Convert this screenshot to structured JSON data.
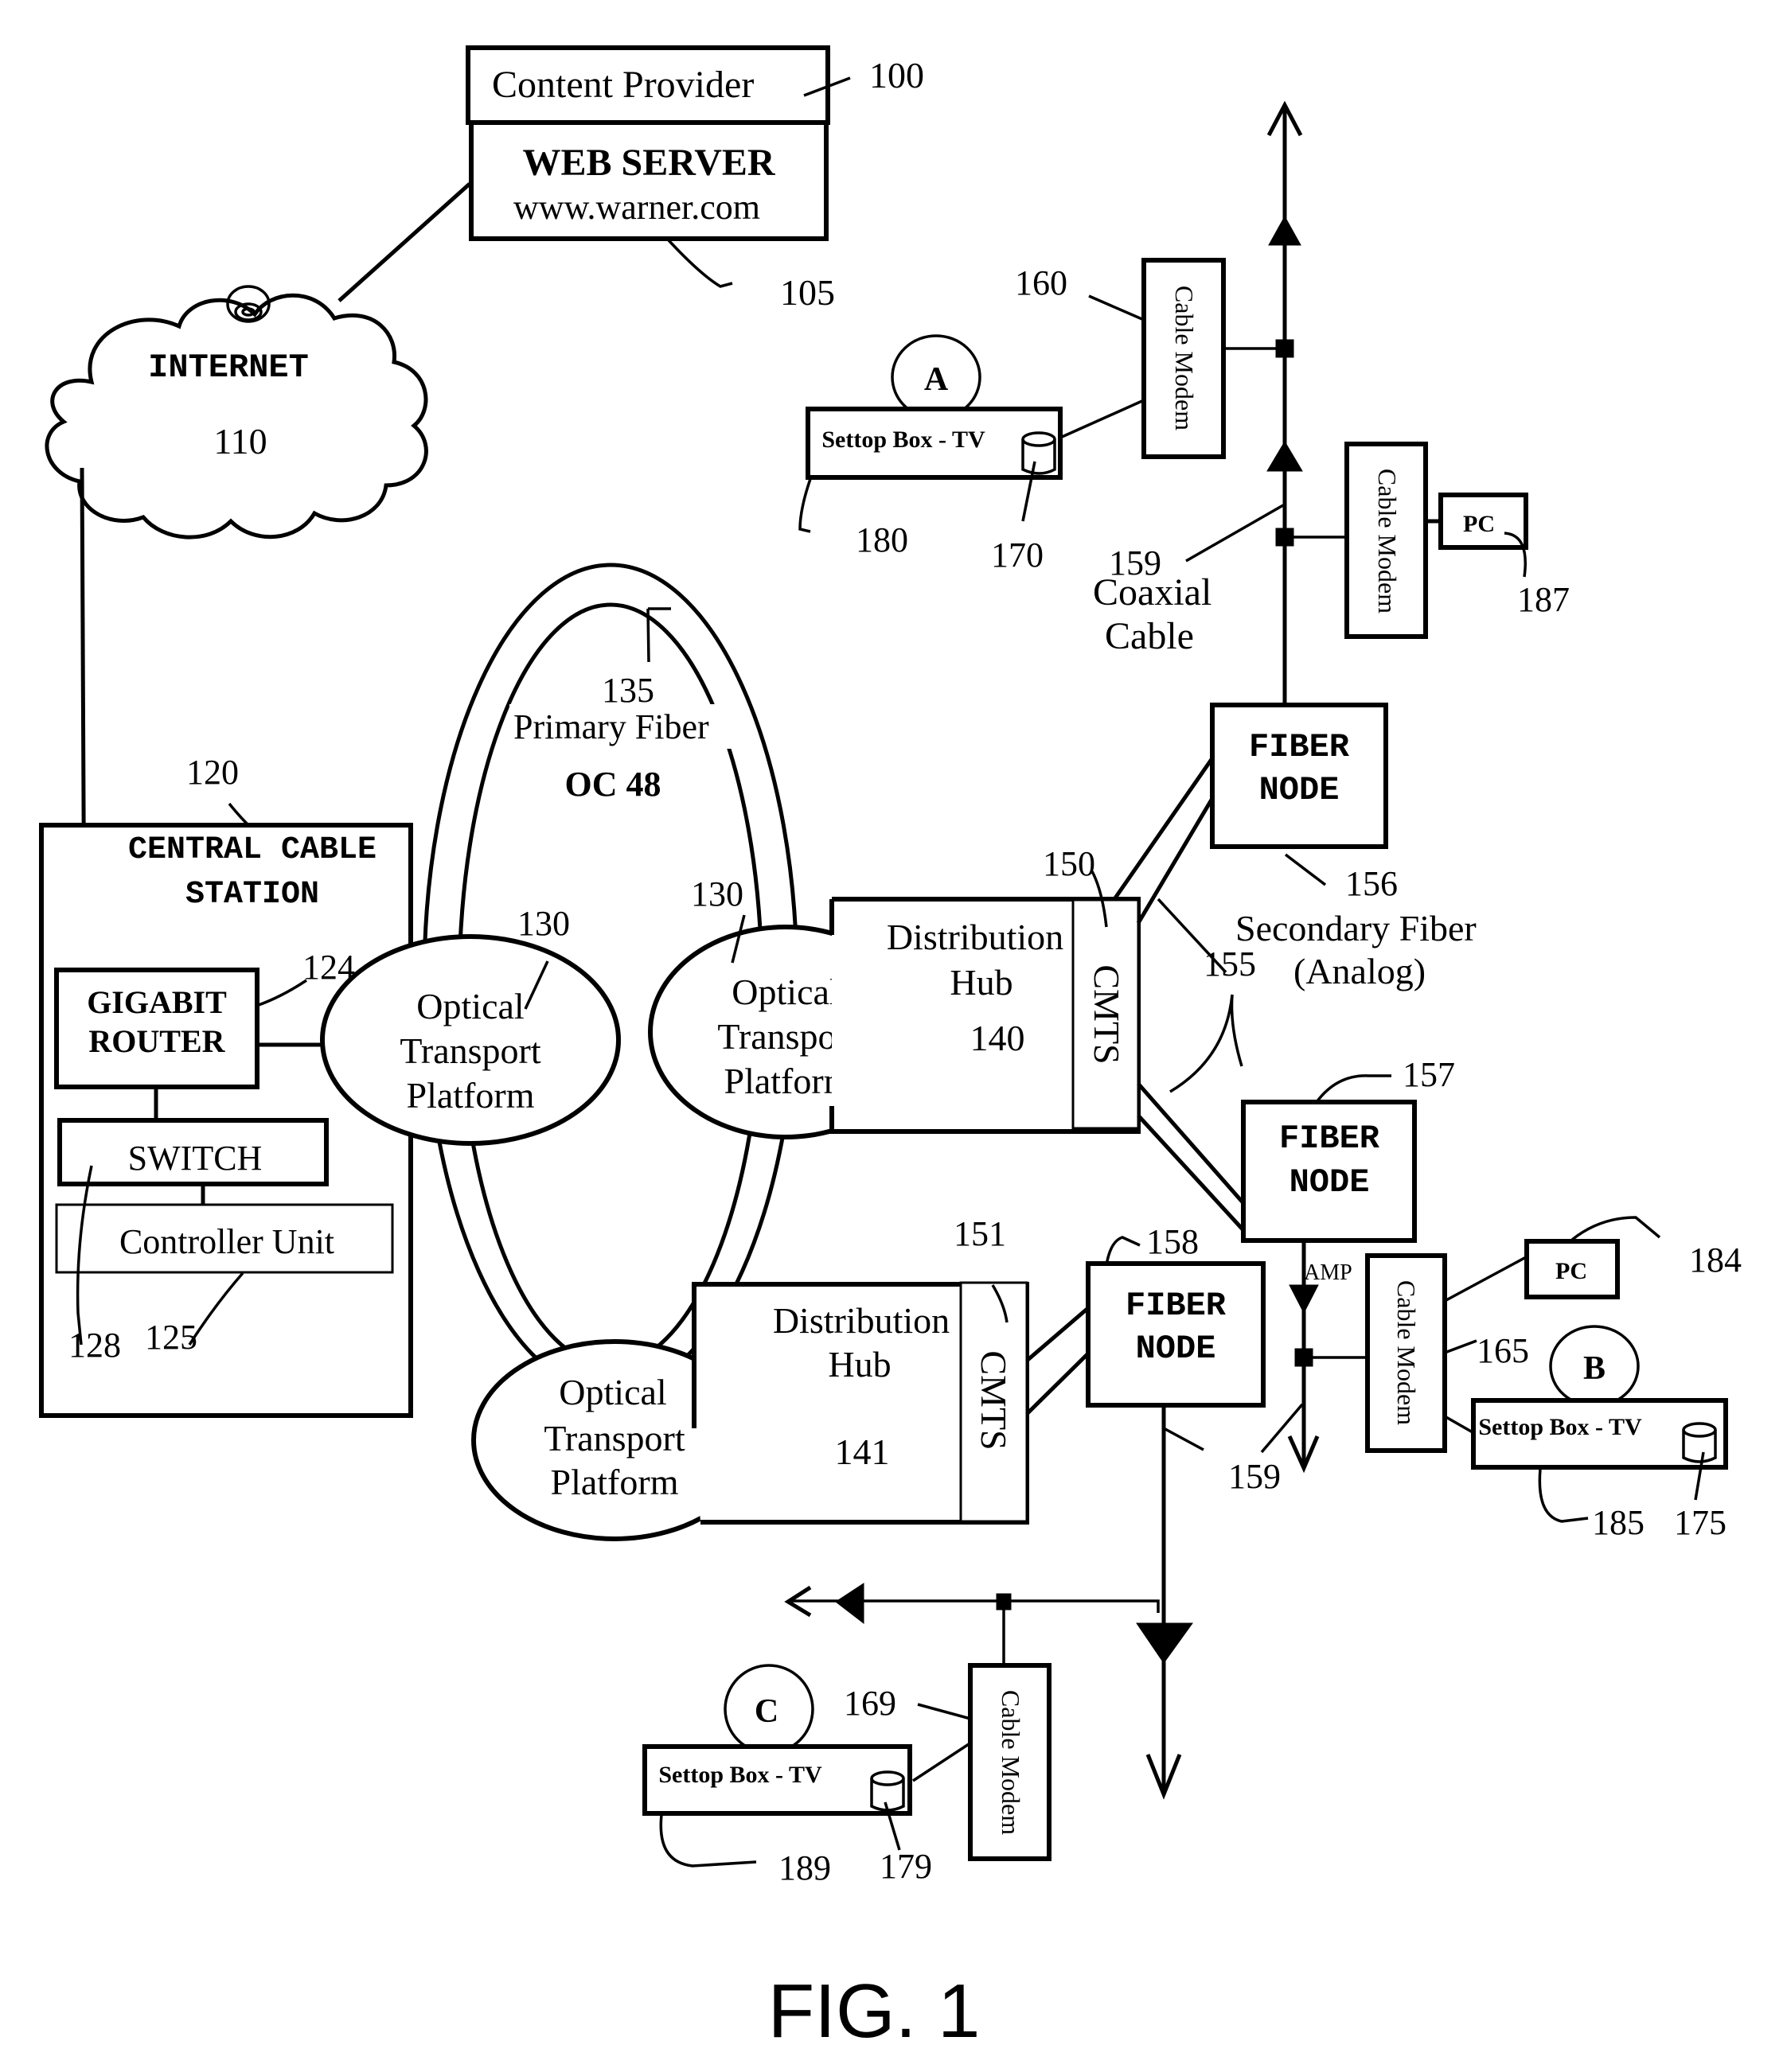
{
  "figure": {
    "caption": "FIG. 1"
  },
  "content_provider": {
    "title": "Content Provider",
    "ref": "100",
    "web_server_title": "WEB SERVER",
    "web_server_url": "www.warner.com",
    "web_server_ref": "105"
  },
  "internet": {
    "label": "INTERNET",
    "ref": "110"
  },
  "central_station": {
    "title_line1": "CENTRAL CABLE",
    "title_line2": "STATION",
    "ref": "120",
    "router_line1": "GIGABIT",
    "router_line2": "ROUTER",
    "router_ref": "124",
    "switch_label": "SWITCH",
    "switch_ref": "128",
    "controller_label": "Controller Unit",
    "controller_ref": "125"
  },
  "primary_fiber": {
    "ref": "135",
    "label": "Primary Fiber",
    "rate": "OC 48"
  },
  "optical_transport": {
    "line1": "Optical",
    "line2": "Transport",
    "line3": "Platform",
    "ref": "130"
  },
  "hubs": [
    {
      "line1": "Distribution",
      "line2": "Hub",
      "ref": "140",
      "cmts_label": "CMTS",
      "cmts_ref": "150"
    },
    {
      "line1": "Distribution",
      "line2": "Hub",
      "ref": "141",
      "cmts_label": "CMTS",
      "cmts_ref": "151"
    }
  ],
  "secondary_fiber": {
    "ref": "155",
    "line1": "Secondary Fiber",
    "line2": "(Analog)"
  },
  "fiber_nodes": [
    {
      "line1": "FIBER",
      "line2": "NODE",
      "ref": "156"
    },
    {
      "line1": "FIBER",
      "line2": "NODE",
      "ref": "157"
    },
    {
      "line1": "FIBER",
      "line2": "NODE",
      "ref": "158"
    }
  ],
  "coax": {
    "ref": "159",
    "line1": "Coaxial",
    "line2": "Cable",
    "amp_label": "AMP"
  },
  "cable_modem_label": "Cable Modem",
  "subscribers": {
    "A": {
      "marker": "A",
      "settop_label": "Settop Box - TV",
      "settop_ref": "180",
      "storage_ref": "170",
      "modem_ref": "160"
    },
    "B": {
      "marker": "B",
      "settop_label": "Settop Box - TV",
      "settop_ref": "185",
      "storage_ref": "175",
      "modem_ref": "165",
      "pc_label": "PC",
      "pc_ref": "184"
    },
    "C": {
      "marker": "C",
      "settop_label": "Settop Box - TV",
      "settop_ref": "189",
      "storage_ref": "179",
      "modem_ref": "169"
    },
    "pc_top": {
      "pc_label": "PC",
      "pc_ref": "187"
    }
  }
}
